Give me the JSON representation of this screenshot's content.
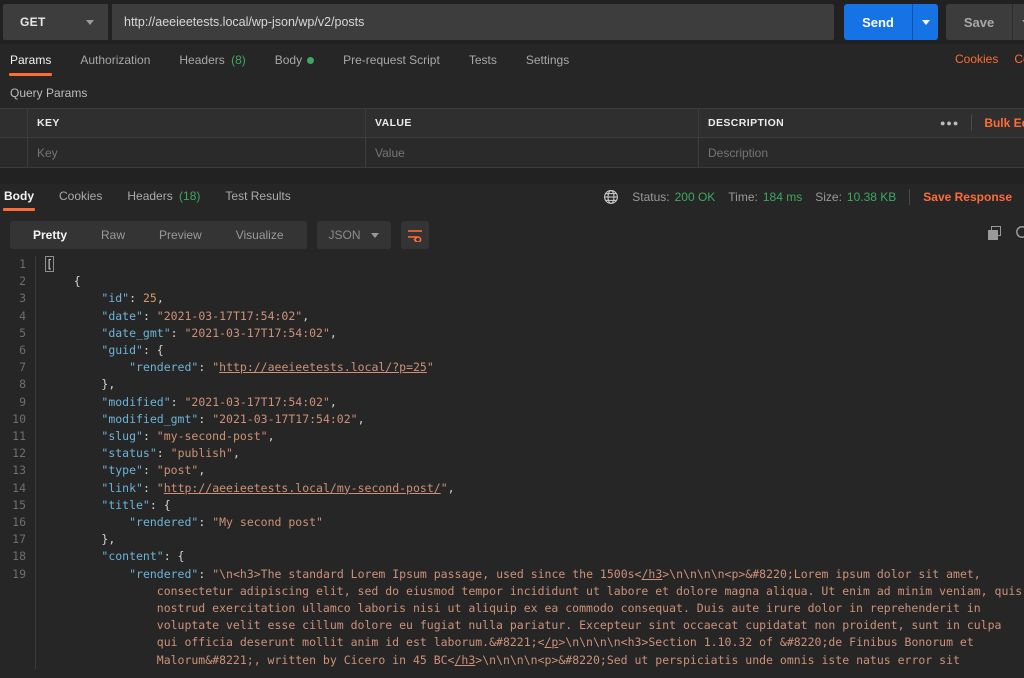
{
  "request": {
    "method": "GET",
    "url": "http://aeeieetests.local/wp-json/wp/v2/posts",
    "send_label": "Send",
    "save_label": "Save",
    "tabs": [
      {
        "label": "Params",
        "active": true
      },
      {
        "label": "Authorization"
      },
      {
        "label": "Headers",
        "count": "(8)"
      },
      {
        "label": "Body",
        "dot": true
      },
      {
        "label": "Pre-request Script"
      },
      {
        "label": "Tests"
      },
      {
        "label": "Settings"
      }
    ],
    "right_links": [
      "Cookies",
      "Code"
    ]
  },
  "query_params": {
    "section_label": "Query Params",
    "columns": {
      "key": "KEY",
      "value": "VALUE",
      "description": "DESCRIPTION"
    },
    "more_icon": "●●●",
    "bulk_edit_label": "Bulk Edit",
    "row_placeholders": {
      "key": "Key",
      "value": "Value",
      "description": "Description"
    }
  },
  "response": {
    "tabs": [
      {
        "label": "Body",
        "active": true
      },
      {
        "label": "Cookies"
      },
      {
        "label": "Headers",
        "count": "(18)"
      },
      {
        "label": "Test Results"
      }
    ],
    "status_label": "Status:",
    "status_value": "200 OK",
    "time_label": "Time:",
    "time_value": "184 ms",
    "size_label": "Size:",
    "size_value": "10.38 KB",
    "save_response_label": "Save Response",
    "view_tabs": [
      {
        "label": "Pretty",
        "active": true
      },
      {
        "label": "Raw"
      },
      {
        "label": "Preview"
      },
      {
        "label": "Visualize"
      }
    ],
    "format_select": "JSON"
  },
  "colors": {
    "accent_orange": "#ff6c37",
    "status_green": "#3da862",
    "send_blue": "#1673e6",
    "json_key": "#6db3d9",
    "json_string": "#ce9178",
    "json_number": "#d19a66"
  },
  "code": {
    "lines": [
      {
        "num": 1,
        "tokens": [
          [
            "c",
            "["
          ]
        ]
      },
      {
        "num": 2,
        "tokens": [
          [
            "p",
            "    {"
          ]
        ]
      },
      {
        "num": 3,
        "tokens": [
          [
            "p",
            "        "
          ],
          [
            "k",
            "\"id\""
          ],
          [
            "p",
            ": "
          ],
          [
            "n",
            "25"
          ],
          [
            "p",
            ","
          ]
        ]
      },
      {
        "num": 4,
        "tokens": [
          [
            "p",
            "        "
          ],
          [
            "k",
            "\"date\""
          ],
          [
            "p",
            ": "
          ],
          [
            "s",
            "\"2021-03-17T17:54:02\""
          ],
          [
            "p",
            ","
          ]
        ]
      },
      {
        "num": 5,
        "tokens": [
          [
            "p",
            "        "
          ],
          [
            "k",
            "\"date_gmt\""
          ],
          [
            "p",
            ": "
          ],
          [
            "s",
            "\"2021-03-17T17:54:02\""
          ],
          [
            "p",
            ","
          ]
        ]
      },
      {
        "num": 6,
        "tokens": [
          [
            "p",
            "        "
          ],
          [
            "k",
            "\"guid\""
          ],
          [
            "p",
            ": {"
          ]
        ]
      },
      {
        "num": 7,
        "tokens": [
          [
            "p",
            "            "
          ],
          [
            "k",
            "\"rendered\""
          ],
          [
            "p",
            ": "
          ],
          [
            "s",
            "\""
          ],
          [
            "l",
            "http://aeeieetests.local/?p=25"
          ],
          [
            "s",
            "\""
          ]
        ]
      },
      {
        "num": 8,
        "tokens": [
          [
            "p",
            "        },"
          ]
        ]
      },
      {
        "num": 9,
        "tokens": [
          [
            "p",
            "        "
          ],
          [
            "k",
            "\"modified\""
          ],
          [
            "p",
            ": "
          ],
          [
            "s",
            "\"2021-03-17T17:54:02\""
          ],
          [
            "p",
            ","
          ]
        ]
      },
      {
        "num": 10,
        "tokens": [
          [
            "p",
            "        "
          ],
          [
            "k",
            "\"modified_gmt\""
          ],
          [
            "p",
            ": "
          ],
          [
            "s",
            "\"2021-03-17T17:54:02\""
          ],
          [
            "p",
            ","
          ]
        ]
      },
      {
        "num": 11,
        "tokens": [
          [
            "p",
            "        "
          ],
          [
            "k",
            "\"slug\""
          ],
          [
            "p",
            ": "
          ],
          [
            "s",
            "\"my-second-post\""
          ],
          [
            "p",
            ","
          ]
        ]
      },
      {
        "num": 12,
        "tokens": [
          [
            "p",
            "        "
          ],
          [
            "k",
            "\"status\""
          ],
          [
            "p",
            ": "
          ],
          [
            "s",
            "\"publish\""
          ],
          [
            "p",
            ","
          ]
        ]
      },
      {
        "num": 13,
        "tokens": [
          [
            "p",
            "        "
          ],
          [
            "k",
            "\"type\""
          ],
          [
            "p",
            ": "
          ],
          [
            "s",
            "\"post\""
          ],
          [
            "p",
            ","
          ]
        ]
      },
      {
        "num": 14,
        "tokens": [
          [
            "p",
            "        "
          ],
          [
            "k",
            "\"link\""
          ],
          [
            "p",
            ": "
          ],
          [
            "s",
            "\""
          ],
          [
            "l",
            "http://aeeieetests.local/my-second-post/"
          ],
          [
            "s",
            "\""
          ],
          [
            "p",
            ","
          ]
        ]
      },
      {
        "num": 15,
        "tokens": [
          [
            "p",
            "        "
          ],
          [
            "k",
            "\"title\""
          ],
          [
            "p",
            ": {"
          ]
        ]
      },
      {
        "num": 16,
        "tokens": [
          [
            "p",
            "            "
          ],
          [
            "k",
            "\"rendered\""
          ],
          [
            "p",
            ": "
          ],
          [
            "s",
            "\"My second post\""
          ]
        ]
      },
      {
        "num": 17,
        "tokens": [
          [
            "p",
            "        },"
          ]
        ]
      },
      {
        "num": 18,
        "tokens": [
          [
            "p",
            "        "
          ],
          [
            "k",
            "\"content\""
          ],
          [
            "p",
            ": {"
          ]
        ]
      },
      {
        "num": 19,
        "wrap": true,
        "tokens": [
          [
            "p",
            "            "
          ],
          [
            "k",
            "\"rendered\""
          ],
          [
            "p",
            ": "
          ],
          [
            "s",
            "\"\\n<h3>The standard Lorem Ipsum passage, used since the 1500s<"
          ],
          [
            "u",
            "/h3"
          ],
          [
            "s",
            ">\\n\\n\\n\\n<p>&#8220;Lorem ipsum dolor sit amet, consectetur adipiscing elit, sed do eiusmod tempor incididunt ut labore et dolore magna aliqua. Ut enim ad minim veniam, quis nostrud exercitation ullamco laboris nisi ut aliquip ex ea commodo consequat. Duis aute irure dolor in reprehenderit in voluptate velit esse cillum dolore eu fugiat nulla pariatur. Excepteur sint occaecat cupidatat non proident, sunt in culpa qui officia deserunt mollit anim id est laborum.&#8221;<"
          ],
          [
            "u",
            "/p"
          ],
          [
            "s",
            ">\\n\\n\\n\\n<h3>Section 1.10.32 of &#8220;de Finibus Bonorum et Malorum&#8221;, written by Cicero in 45 BC<"
          ],
          [
            "u",
            "/h3"
          ],
          [
            "s",
            ">\\n\\n\\n\\n<p>&#8220;Sed ut perspiciatis unde omnis iste natus error sit"
          ]
        ]
      }
    ]
  }
}
